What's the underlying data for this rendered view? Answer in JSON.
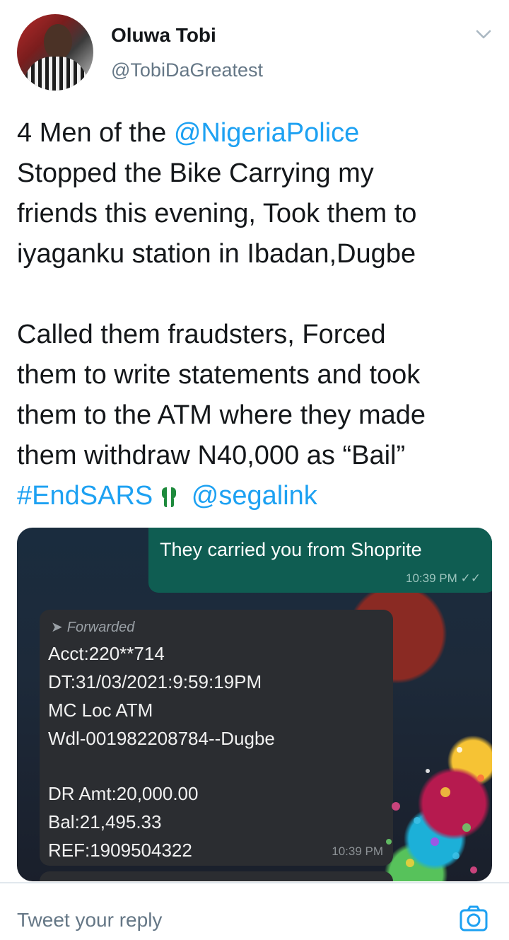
{
  "author": {
    "name": "Oluwa Tobi",
    "handle": "@TobiDaGreatest"
  },
  "tweet": {
    "line1_prefix": "4 Men of the ",
    "line1_mention": "@NigeriaPolice",
    "line2": "Stopped the Bike Carrying my",
    "line3": "friends this evening, Took them to",
    "line4": "iyaganku station in Ibadan,Dugbe",
    "line5": "Called them fraudsters, Forced",
    "line6": "them to write statements and took",
    "line7": "them to the ATM where they made",
    "line8": "them withdraw N40,000 as “Bail”",
    "hashtag": "#EndSARS",
    "mention2": "@segalink"
  },
  "media": {
    "outgoing_message": "They carried you from Shoprite",
    "outgoing_time": "10:39 PM",
    "forwarded_label": "Forwarded",
    "sms_lines": [
      "Acct:220**714",
      "DT:31/03/2021:9:59:19PM",
      "MC Loc ATM",
      "Wdl-001982208784--Dugbe",
      "DR Amt:20,000.00",
      "Bal:21,495.33",
      "REF:1909504322"
    ],
    "incoming_time": "10:39 PM"
  },
  "reply": {
    "placeholder": "Tweet your reply"
  },
  "colors": {
    "link": "#1da1f2",
    "text": "#14171a",
    "secondary": "#657786"
  }
}
